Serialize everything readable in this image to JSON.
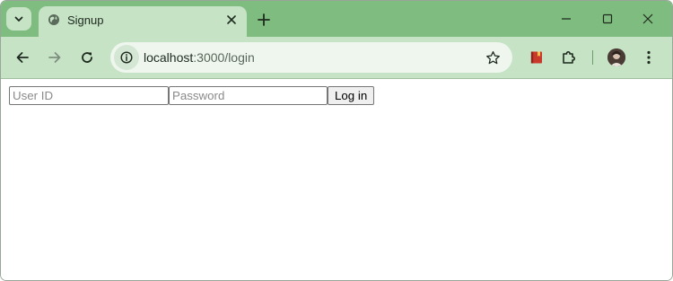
{
  "browser": {
    "tab": {
      "title": "Signup",
      "favicon": "globe-icon",
      "close_icon": "close-icon"
    },
    "new_tab_icon": "plus-icon",
    "tab_search_icon": "chevron-down-icon",
    "window_controls": [
      "minimize-icon",
      "maximize-icon",
      "close-icon"
    ],
    "toolbar": {
      "back_icon": "arrow-left-icon",
      "forward_icon": "arrow-right-icon",
      "reload_icon": "reload-icon",
      "site_info_icon": "info-icon",
      "url_host": "localhost",
      "url_path": ":3000/login",
      "bookmark_icon": "star-icon",
      "extension_icons": [
        "bookmark-book-icon",
        "puzzle-icon"
      ],
      "profile_icon": "avatar",
      "menu_icon": "kebab-menu-icon"
    },
    "colors": {
      "frame": "#7fbc7f",
      "toolbar": "#c6e3c6",
      "omnibox": "#eef6ee"
    }
  },
  "page": {
    "login_form": {
      "userid_placeholder": "User ID",
      "password_placeholder": "Password",
      "submit_label": "Log in"
    }
  }
}
